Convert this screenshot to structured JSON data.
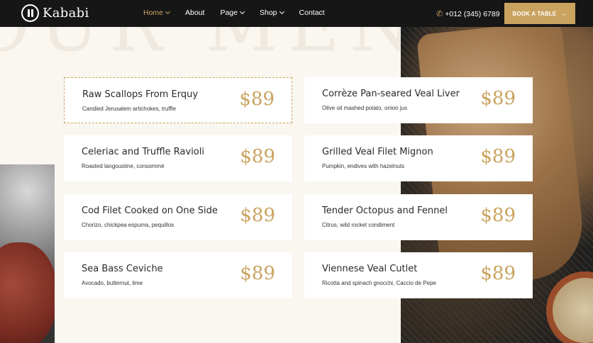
{
  "header": {
    "brand": "Kababi",
    "nav": [
      {
        "label": "Home",
        "has_dropdown": true,
        "active": true
      },
      {
        "label": "About",
        "has_dropdown": false,
        "active": false
      },
      {
        "label": "Page",
        "has_dropdown": true,
        "active": false
      },
      {
        "label": "Shop",
        "has_dropdown": true,
        "active": false
      },
      {
        "label": "Contact",
        "has_dropdown": false,
        "active": false
      }
    ],
    "phone": "+012 (345) 6789",
    "book_button": "BOOK A TABLE"
  },
  "section": {
    "background_title": "OUR MENU"
  },
  "menu": [
    {
      "name": "Raw Scallops From Erquy",
      "description": "Candied Jerusalem artichokes, truffle",
      "price": "$89",
      "highlighted": true
    },
    {
      "name": "Corrèze Pan-seared Veal Liver",
      "description": "Olive oil mashed potato, onion jus",
      "price": "$89",
      "highlighted": false
    },
    {
      "name": "Celeriac and Truffle Ravioli",
      "description": "Roasted langoustine, consommé",
      "price": "$89",
      "highlighted": false
    },
    {
      "name": "Grilled Veal Filet Mignon",
      "description": "Pumpkin, endives with hazelnuts",
      "price": "$89",
      "highlighted": false
    },
    {
      "name": "Cod Filet Cooked on One Side",
      "description": "Chorizo, chickpea espuma, pequillos",
      "price": "$89",
      "highlighted": false
    },
    {
      "name": "Tender Octopus and Fennel",
      "description": "Citrus, wild rocket condiment",
      "price": "$89",
      "highlighted": false
    },
    {
      "name": "Sea Bass Ceviche",
      "description": "Avocado, butternut, lime",
      "price": "$89",
      "highlighted": false
    },
    {
      "name": "Viennese Veal Cutlet",
      "description": "Ricotta and spinach gnocchi, Caccio de Pepe",
      "price": "$89",
      "highlighted": false
    }
  ],
  "colors": {
    "accent": "#c9a35f",
    "header_bg": "#161616",
    "page_bg": "#faf6f0"
  }
}
